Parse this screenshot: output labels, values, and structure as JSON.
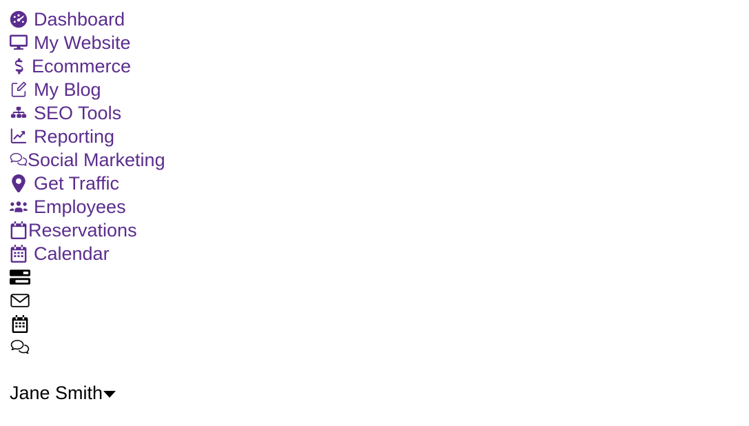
{
  "theme": {
    "accent_color": "#5B2D8E",
    "text_color": "#000000",
    "background_color": "#FFFFFF"
  },
  "nav": {
    "items": [
      {
        "label": "Dashboard",
        "icon": "tachometer-icon"
      },
      {
        "label": "My Website",
        "icon": "desktop-icon"
      },
      {
        "label": "Ecommerce",
        "icon": "dollar-sign-icon"
      },
      {
        "label": "My Blog",
        "icon": "pen-square-icon"
      },
      {
        "label": "SEO Tools",
        "icon": "sitemap-icon"
      },
      {
        "label": "Reporting",
        "icon": "chart-line-icon"
      },
      {
        "label": "Social Marketing",
        "icon": "comments-icon"
      },
      {
        "label": "Get Traffic",
        "icon": "map-marker-icon"
      },
      {
        "label": "Employees",
        "icon": "users-icon"
      },
      {
        "label": "Reservations",
        "icon": "calendar-icon"
      },
      {
        "label": "Calendar",
        "icon": "calendar-alt-icon"
      }
    ]
  },
  "utility": {
    "items": [
      {
        "label": "",
        "icon": "tasks-icon"
      },
      {
        "label": "",
        "icon": "envelope-icon"
      },
      {
        "label": "",
        "icon": "calendar-alt-icon"
      },
      {
        "label": "",
        "icon": "comments-icon"
      }
    ]
  },
  "user": {
    "name": "Jane Smith",
    "caret": "caret-down-icon"
  }
}
